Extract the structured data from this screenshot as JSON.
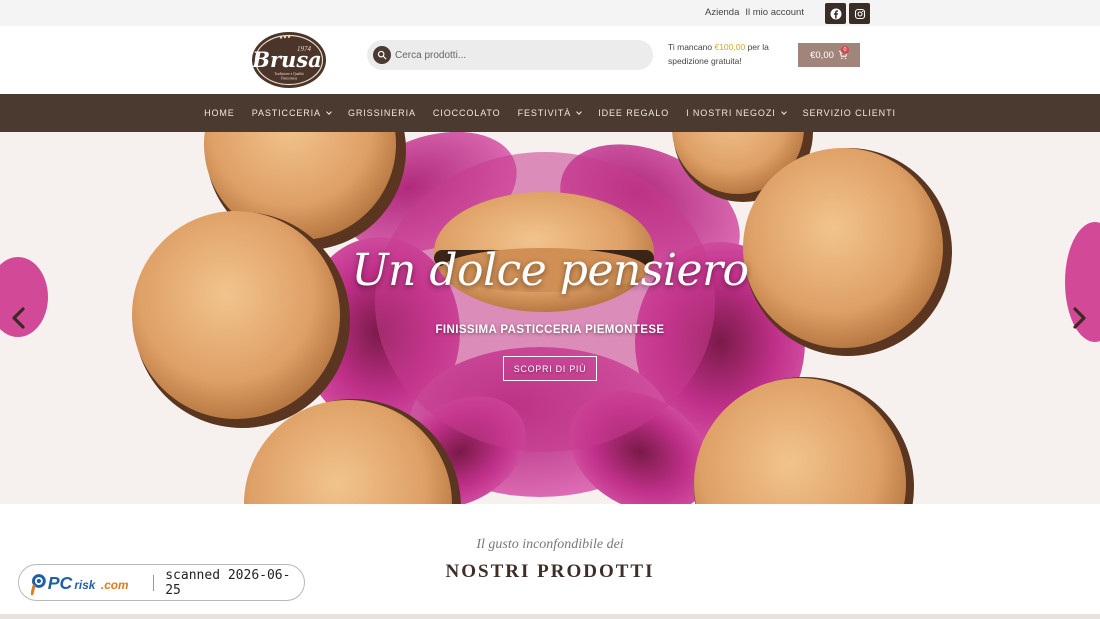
{
  "topbar": {
    "links": [
      "Azienda",
      "Il mio account"
    ],
    "social": [
      {
        "icon": "facebook-icon"
      },
      {
        "icon": "instagram-icon"
      }
    ]
  },
  "header": {
    "logo": {
      "brand": "Brusa",
      "year": "1974",
      "tagline_1": "Tradizione e Qualità",
      "tagline_2": "Piemontese"
    },
    "search": {
      "placeholder": "Cerca prodotti..."
    },
    "shipping": {
      "prefix": "Ti mancano ",
      "amount": "€100,00",
      "suffix": " per la spedizione gratuita!"
    },
    "cart": {
      "total": "€0,00",
      "count": "0"
    }
  },
  "nav": {
    "items": [
      {
        "label": "Home",
        "dropdown": false
      },
      {
        "label": "Pasticceria",
        "dropdown": true
      },
      {
        "label": "Grissineria",
        "dropdown": false
      },
      {
        "label": "Cioccolato",
        "dropdown": false
      },
      {
        "label": "Festività",
        "dropdown": true
      },
      {
        "label": "Idee Regalo",
        "dropdown": false
      },
      {
        "label": "I Nostri Negozi",
        "dropdown": true
      },
      {
        "label": "Servizio Clienti",
        "dropdown": false
      }
    ]
  },
  "hero": {
    "title": "Un dolce pensiero",
    "subtitle": "FINISSIMA PASTICCERIA PIEMONTESE",
    "button": "SCOPRI DI PIÙ"
  },
  "products": {
    "pre_title": "Il gusto inconfondibile dei",
    "title": "NOSTRI PRODOTTI"
  },
  "watermark": {
    "brand": "PCrisk.com",
    "text": "scanned 2026-06-25"
  },
  "colors": {
    "nav_bg": "#4b3a30",
    "cart_bg": "#a1857a",
    "accent_amount": "#d9a520",
    "heading": "#3d2f28"
  }
}
